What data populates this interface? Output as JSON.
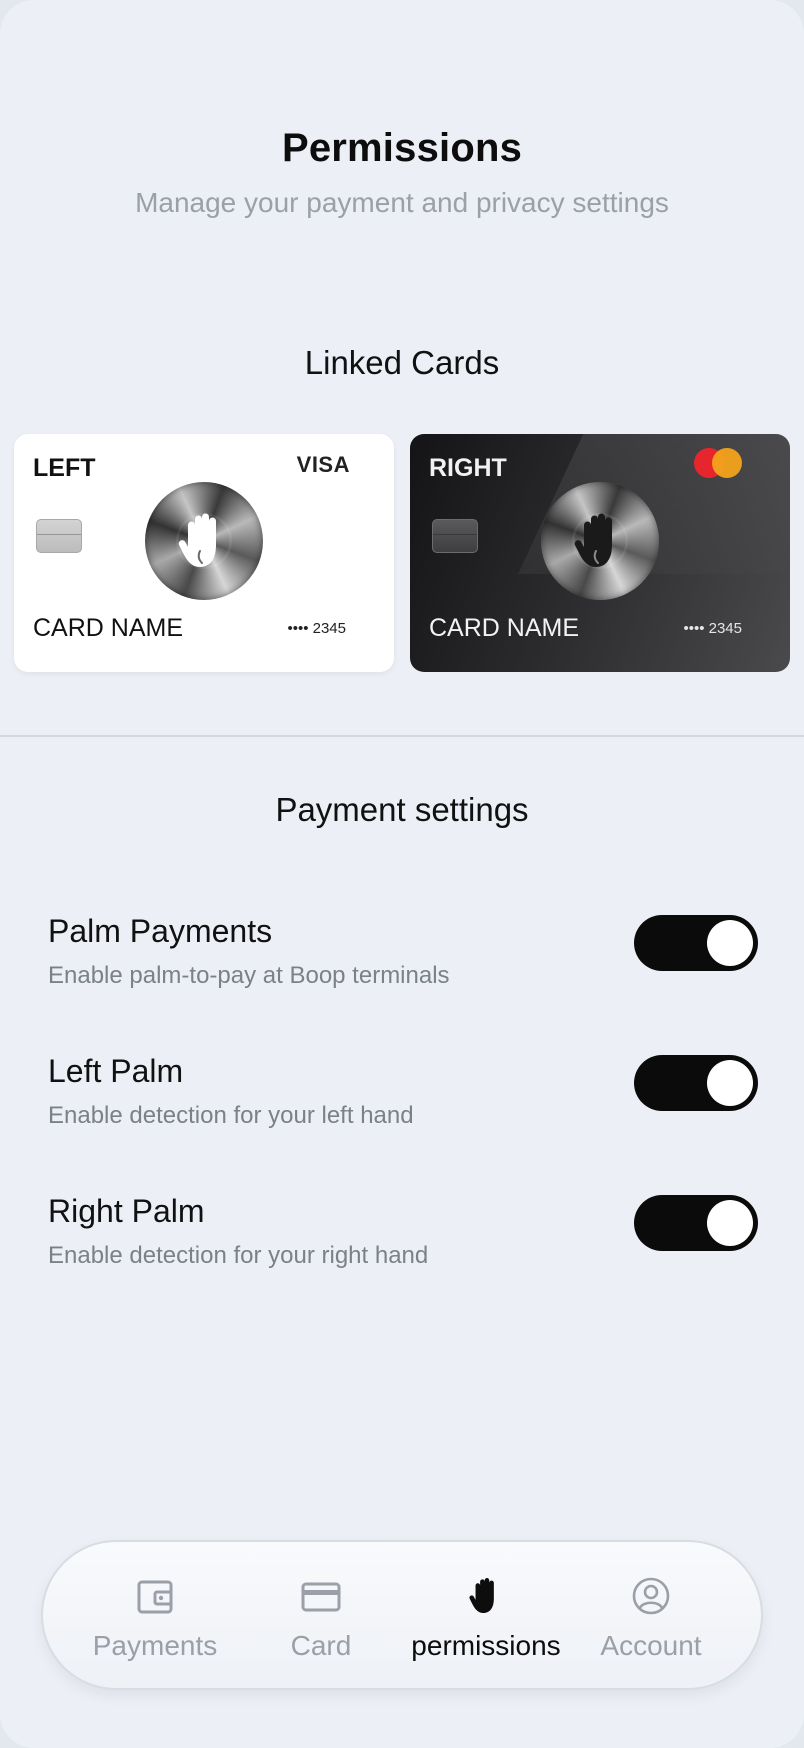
{
  "header": {
    "title": "Permissions",
    "subtitle": "Manage your payment and privacy settings"
  },
  "linked_cards": {
    "section_title": "Linked Cards",
    "cards": [
      {
        "side": "LEFT",
        "brand": "VISA",
        "name": "CARD NAME",
        "number": "•••• 2345",
        "theme": "light"
      },
      {
        "side": "RIGHT",
        "brand": "mastercard-icon",
        "name": "CARD NAME",
        "number": "•••• 2345",
        "theme": "dark"
      }
    ]
  },
  "payment_settings": {
    "section_title": "Payment settings",
    "items": [
      {
        "title": "Palm Payments",
        "description": "Enable palm-to-pay at Boop terminals",
        "enabled": true
      },
      {
        "title": "Left Palm",
        "description": "Enable detection for your left hand",
        "enabled": true
      },
      {
        "title": "Right Palm",
        "description": "Enable detection for your right hand",
        "enabled": true
      }
    ]
  },
  "nav": {
    "items": [
      {
        "label": "Payments",
        "icon": "wallet-icon",
        "active": false
      },
      {
        "label": "Card",
        "icon": "card-icon",
        "active": false
      },
      {
        "label": "permissions",
        "icon": "palm-icon",
        "active": true
      },
      {
        "label": "Account",
        "icon": "user-circle-icon",
        "active": false
      }
    ]
  },
  "colors": {
    "background": "#eceff5",
    "toggle_on": "#0b0b0b",
    "muted_text": "#9aa0a8",
    "mastercard_red": "#e6262c",
    "mastercard_orange": "#f4a21b"
  }
}
